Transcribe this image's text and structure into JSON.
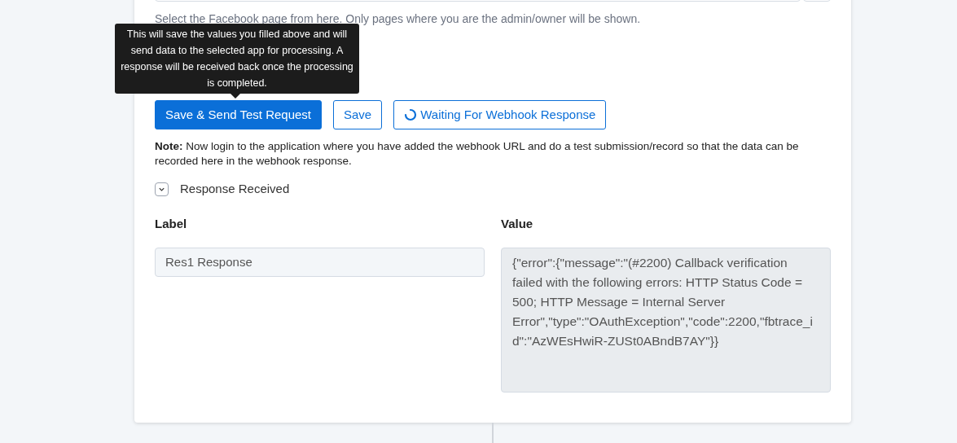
{
  "page_select": {
    "help": "Select the Facebook page from here. Only pages where you are the admin/owner will be shown."
  },
  "tooltip": {
    "text": "This will save the values you filled above and will send data to the selected app for processing. A response will be received back once the processing is completed."
  },
  "buttons": [
    {
      "label": "Save & Send Test Request",
      "kind": "primary"
    },
    {
      "label": "Save",
      "kind": "outline"
    },
    {
      "label": "Waiting For Webhook Response",
      "kind": "loading"
    }
  ],
  "note": "**Note:** Now login to the application where you have added the webhook URL and do a test submission/record so that the data can be recorded here in the webhook response.",
  "response": {
    "title": "Response Received",
    "expanded": true
  },
  "columns": [
    "Label",
    "Value"
  ],
  "fields": [
    {
      "label": "Res1 Response",
      "value": "{\"error\":{\"message\":\"(#2200) Callback verification failed with the following errors: HTTP Status Code = 500; HTTP Message = Internal Server Error\",\"type\":\"OAuthException\",\"code\":2200,\"fbtrace_id\":\"AzWEsHwiR-ZUSt0ABndB7AY\"}}"
    }
  ]
}
